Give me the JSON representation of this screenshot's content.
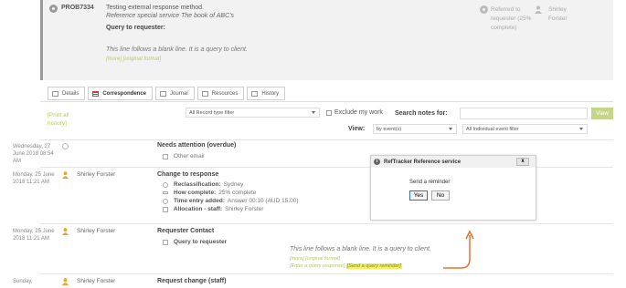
{
  "problem": {
    "id": "PROB7334",
    "title": "Testing external response method.",
    "subtitle": "Reference special service The book of ABC's",
    "query_label": "Query to requester:",
    "query_text": "This line follows a blank line.  It is a query to client.",
    "links": "[more]  [original format]",
    "status": "Referred to requester (25% complete)",
    "assignee": "Shirley Forster"
  },
  "tabs": [
    {
      "label": "Details"
    },
    {
      "label": "Correspondence"
    },
    {
      "label": "Journal"
    },
    {
      "label": "Resources"
    },
    {
      "label": "History"
    }
  ],
  "filters": {
    "print_link": "[Print all history]",
    "record_type": "All Record type filter",
    "exclude_label": "Exclude my work",
    "search_label": "Search notes for:",
    "view_button": "View",
    "view_label": "View:",
    "view_by": "by event(s)",
    "event_filter": "All Individual event filter"
  },
  "events": [
    {
      "date": "Wednesday, 27 June 2018 08:54 AM",
      "person": "",
      "title": "Needs attention (overdue)",
      "lines": [
        {
          "icon": "email-icon",
          "bold": "",
          "text": "Other email"
        }
      ]
    },
    {
      "date": "Monday, 25 June 2018 11:21 AM",
      "person": "Shirley Forster",
      "title": "Change to response",
      "lines": [
        {
          "icon": "location-icon",
          "bold": "Reclassification:",
          "text": "Sydney"
        },
        {
          "icon": "progress-icon",
          "bold": "How complete:",
          "text": "25% complete"
        },
        {
          "icon": "clock-icon",
          "bold": "Time entry added:",
          "text": "Answer  00:10  (AUD 15.00)"
        },
        {
          "icon": "staff-icon",
          "bold": "Allocation - staff:",
          "text": "Shirley Forster"
        }
      ]
    },
    {
      "date": "Monday, 25 June 2018 11:21 AM",
      "person": "Shirley Forster",
      "title": "Requester Contact",
      "lines": [
        {
          "icon": "document-icon",
          "bold": "Query to requester",
          "text": ""
        }
      ]
    },
    {
      "date": "Sunday,",
      "person": "Shirley Forster",
      "title": "Request change (staff)",
      "lines": []
    }
  ],
  "query": {
    "text": "This line follows a blank line.  It is a query to client.",
    "links1": "[more]  [original format]",
    "links2": "[Enter a query response]",
    "reminder": "[Send a query reminder]"
  },
  "dialog": {
    "title": "RefTracker Reference service",
    "close": "x",
    "message": "Send a reminder",
    "yes": "Yes",
    "no": "No"
  },
  "colors": {
    "accent_green": "#b6c96a",
    "highlight_yellow": "#f4f055",
    "arrow_orange": "#e8702a"
  }
}
